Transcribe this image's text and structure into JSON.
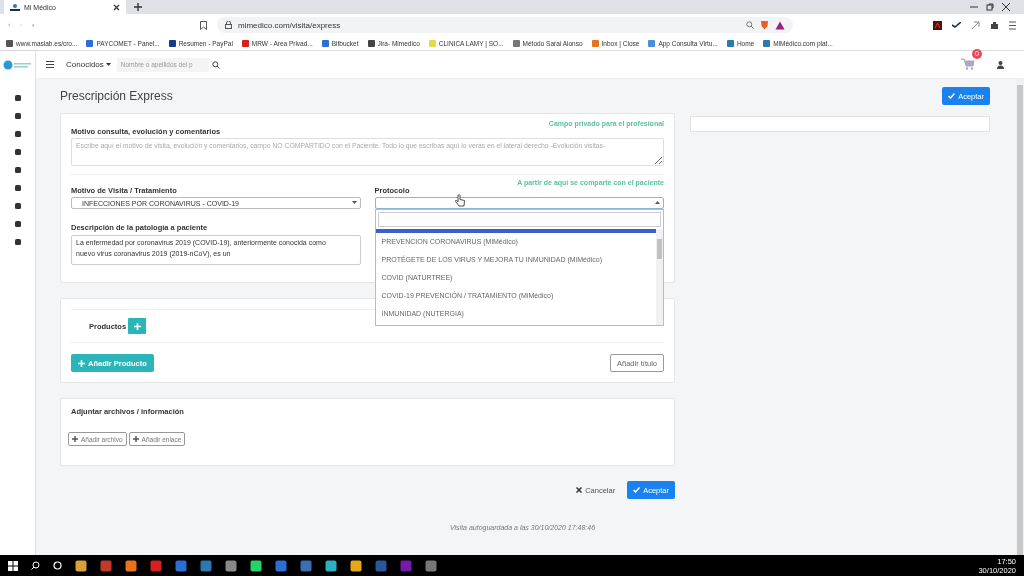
{
  "browser": {
    "tab_title": "Mi Médico",
    "url": "mimedico.com/visita/express",
    "bookmarks": [
      {
        "label": "www.maslab.es/cro...",
        "color": "#555555"
      },
      {
        "label": "PAYCOMET - Panel...",
        "color": "#2a6fd6"
      },
      {
        "label": "Resumen - PayPal",
        "color": "#1a3b8a"
      },
      {
        "label": "MRW - Area Privad...",
        "color": "#d42020"
      },
      {
        "label": "Bitbucket",
        "color": "#2a6fd6"
      },
      {
        "label": "Jira- Mimedico",
        "color": "#444444"
      },
      {
        "label": "CLINICA LAMY | SO...",
        "color": "#e6d84a"
      },
      {
        "label": "Método Sarai Alonso",
        "color": "#777777"
      },
      {
        "label": "Inbox | Close",
        "color": "#e8731c"
      },
      {
        "label": "App Consulta Virtu...",
        "color": "#4a90d9"
      },
      {
        "label": "Home",
        "color": "#2a7ab0"
      },
      {
        "label": "MiMédico.com plat...",
        "color": "#2a7ab0"
      }
    ]
  },
  "topbar": {
    "menu": "Conocidos",
    "search_placeholder": "Nombre o apellidos del p",
    "cart_badge": "0"
  },
  "page": {
    "title": "Prescripción Express",
    "accept": "Aceptar"
  },
  "consultation": {
    "label": "Motivo consulta, evolución y comentarios",
    "note": "Campo privado para el profesional",
    "placeholder": "Escribe aquí el motivo de visita, evolución y comentarios, campo NO COMPARTIDO con el Paciente. Todo lo que escribas aquí lo verás en el lateral derecho -Evolución visitas-"
  },
  "shared_note": "A partir de aquí se comparte con el paciente",
  "visit_reason": {
    "label": "Motivo de Visita / Tratamiento",
    "value": "INFECCIONES POR CORONAVIRUS - COVID-19"
  },
  "description": {
    "label": "Descripción de la patología a paciente",
    "value": "La enfermedad por coronavirus 2019 (COVID-19), anteriormente conocida como nuevo virus coronavirus 2019 (2019-nCoV), es un"
  },
  "protocol": {
    "label": "Protocolo",
    "options": [
      {
        "label": "PREVENCION CORONAVIRUS (MiMédico)",
        "selected": false
      },
      {
        "label": "PROTÉGETE DE LOS VIRUS Y MEJORA TU INMUNIDAD (MiMédico)",
        "selected": false
      },
      {
        "label": "COVID (NATURTREE)",
        "selected": false
      },
      {
        "label": "COVID-19 PREVENCIÓN / TRATAMIENTO (MiMédico)",
        "selected": false
      },
      {
        "label": "INMUNIDAD (NUTERGIA)",
        "selected": false
      }
    ]
  },
  "products": {
    "label": "Productos",
    "add_product": "Añadir Producto",
    "add_title": "Añadir título"
  },
  "attachments": {
    "title": "Adjuntar archivos / información",
    "buttons": [
      "Añadir archivo",
      "Añadir enlace"
    ]
  },
  "footer": {
    "cancel": "Cancelar",
    "accept": "Aceptar",
    "autosave": "Visita autoguardada a las 30/10/2020 17:48:46"
  },
  "taskbar": {
    "time": "17:50",
    "date": "30/10/2020"
  }
}
